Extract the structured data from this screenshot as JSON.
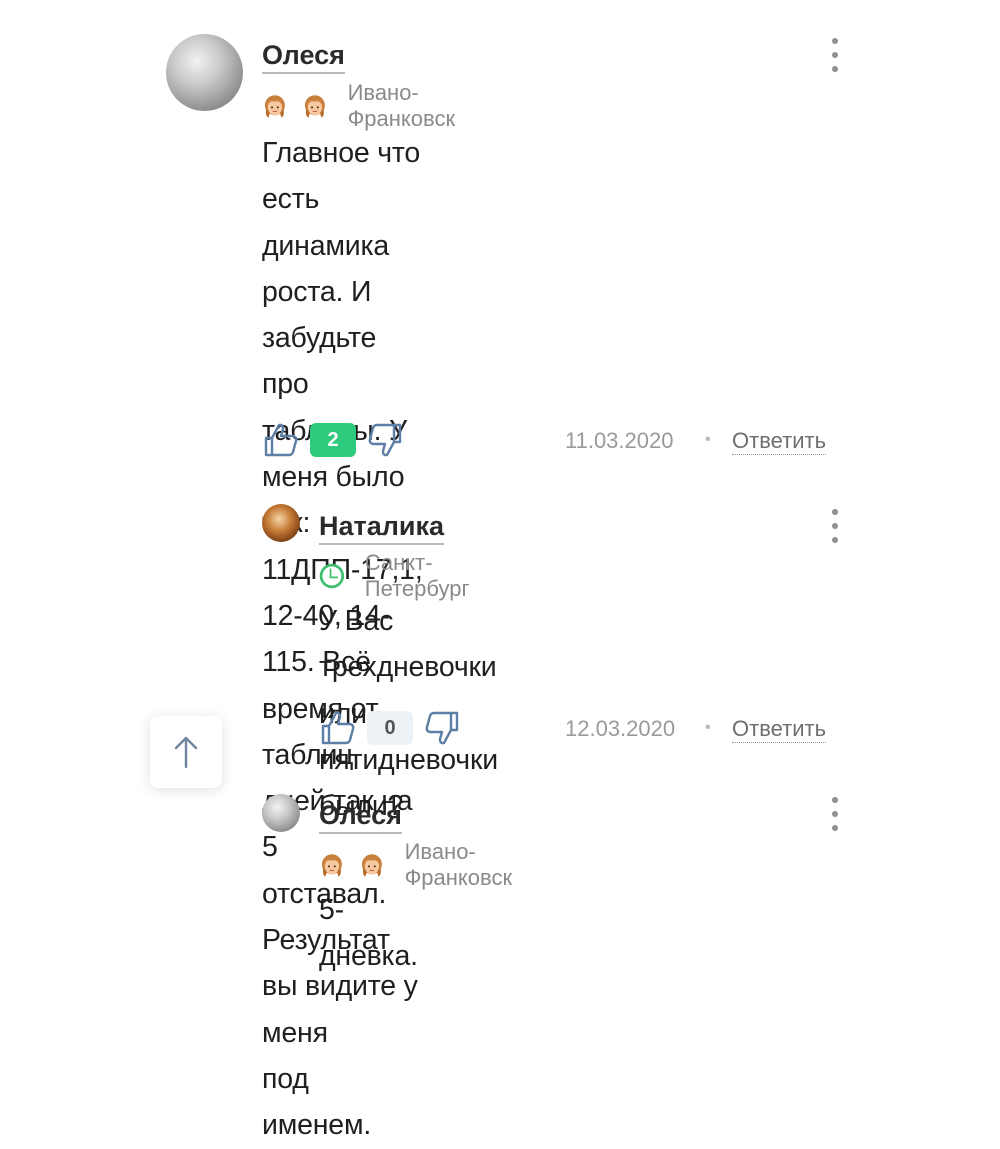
{
  "comments": [
    {
      "author": "Олеся",
      "city": "Ивано-Франковск",
      "text": "Главное что есть динамика роста. И\nзабудьте про таблицы. У меня было\nтак: 11ДПП-17,1, 12-40, 14-115. Всё\nвремя от таблиц дней так на 5\nотставал. Результат вы видите у меня\nпод именем.",
      "likes": "2",
      "date": "11.03.2020",
      "reply_label": "Ответить",
      "status_icons": [
        "girl-icon",
        "girl-icon"
      ]
    },
    {
      "author": "Наталика",
      "city": "Санкт-Петербург",
      "text": "У Вас трехдневочки или\nпятидневочки были?",
      "likes": "0",
      "date": "12.03.2020",
      "reply_label": "Ответить",
      "status_icons": [
        "clock-icon"
      ]
    },
    {
      "author": "Олеся",
      "city": "Ивано-Франковск",
      "text": "5-дневка.",
      "status_icons": [
        "girl-icon",
        "girl-icon"
      ]
    }
  ],
  "separator": "•",
  "colors": {
    "like_badge": "#2fca7c",
    "neutral_badge": "#edf2f7",
    "clock": "#3dbf6e"
  }
}
